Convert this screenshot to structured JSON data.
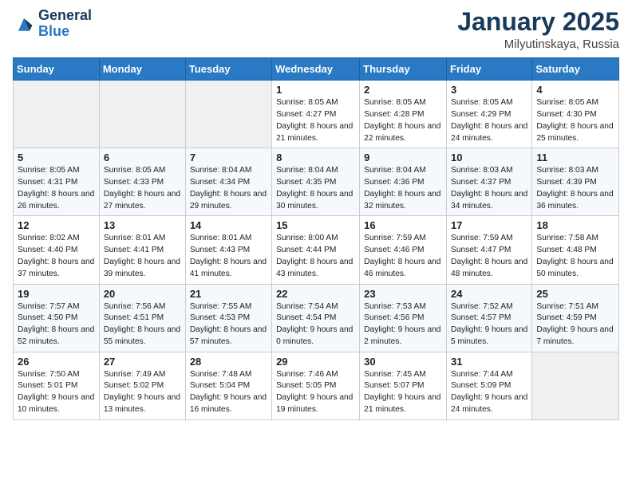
{
  "header": {
    "logo_general": "General",
    "logo_blue": "Blue",
    "month_year": "January 2025",
    "location": "Milyutinskaya, Russia"
  },
  "days_of_week": [
    "Sunday",
    "Monday",
    "Tuesday",
    "Wednesday",
    "Thursday",
    "Friday",
    "Saturday"
  ],
  "weeks": [
    [
      {
        "day": "",
        "info": ""
      },
      {
        "day": "",
        "info": ""
      },
      {
        "day": "",
        "info": ""
      },
      {
        "day": "1",
        "info": "Sunrise: 8:05 AM\nSunset: 4:27 PM\nDaylight: 8 hours and 21 minutes."
      },
      {
        "day": "2",
        "info": "Sunrise: 8:05 AM\nSunset: 4:28 PM\nDaylight: 8 hours and 22 minutes."
      },
      {
        "day": "3",
        "info": "Sunrise: 8:05 AM\nSunset: 4:29 PM\nDaylight: 8 hours and 24 minutes."
      },
      {
        "day": "4",
        "info": "Sunrise: 8:05 AM\nSunset: 4:30 PM\nDaylight: 8 hours and 25 minutes."
      }
    ],
    [
      {
        "day": "5",
        "info": "Sunrise: 8:05 AM\nSunset: 4:31 PM\nDaylight: 8 hours and 26 minutes."
      },
      {
        "day": "6",
        "info": "Sunrise: 8:05 AM\nSunset: 4:33 PM\nDaylight: 8 hours and 27 minutes."
      },
      {
        "day": "7",
        "info": "Sunrise: 8:04 AM\nSunset: 4:34 PM\nDaylight: 8 hours and 29 minutes."
      },
      {
        "day": "8",
        "info": "Sunrise: 8:04 AM\nSunset: 4:35 PM\nDaylight: 8 hours and 30 minutes."
      },
      {
        "day": "9",
        "info": "Sunrise: 8:04 AM\nSunset: 4:36 PM\nDaylight: 8 hours and 32 minutes."
      },
      {
        "day": "10",
        "info": "Sunrise: 8:03 AM\nSunset: 4:37 PM\nDaylight: 8 hours and 34 minutes."
      },
      {
        "day": "11",
        "info": "Sunrise: 8:03 AM\nSunset: 4:39 PM\nDaylight: 8 hours and 36 minutes."
      }
    ],
    [
      {
        "day": "12",
        "info": "Sunrise: 8:02 AM\nSunset: 4:40 PM\nDaylight: 8 hours and 37 minutes."
      },
      {
        "day": "13",
        "info": "Sunrise: 8:01 AM\nSunset: 4:41 PM\nDaylight: 8 hours and 39 minutes."
      },
      {
        "day": "14",
        "info": "Sunrise: 8:01 AM\nSunset: 4:43 PM\nDaylight: 8 hours and 41 minutes."
      },
      {
        "day": "15",
        "info": "Sunrise: 8:00 AM\nSunset: 4:44 PM\nDaylight: 8 hours and 43 minutes."
      },
      {
        "day": "16",
        "info": "Sunrise: 7:59 AM\nSunset: 4:46 PM\nDaylight: 8 hours and 46 minutes."
      },
      {
        "day": "17",
        "info": "Sunrise: 7:59 AM\nSunset: 4:47 PM\nDaylight: 8 hours and 48 minutes."
      },
      {
        "day": "18",
        "info": "Sunrise: 7:58 AM\nSunset: 4:48 PM\nDaylight: 8 hours and 50 minutes."
      }
    ],
    [
      {
        "day": "19",
        "info": "Sunrise: 7:57 AM\nSunset: 4:50 PM\nDaylight: 8 hours and 52 minutes."
      },
      {
        "day": "20",
        "info": "Sunrise: 7:56 AM\nSunset: 4:51 PM\nDaylight: 8 hours and 55 minutes."
      },
      {
        "day": "21",
        "info": "Sunrise: 7:55 AM\nSunset: 4:53 PM\nDaylight: 8 hours and 57 minutes."
      },
      {
        "day": "22",
        "info": "Sunrise: 7:54 AM\nSunset: 4:54 PM\nDaylight: 9 hours and 0 minutes."
      },
      {
        "day": "23",
        "info": "Sunrise: 7:53 AM\nSunset: 4:56 PM\nDaylight: 9 hours and 2 minutes."
      },
      {
        "day": "24",
        "info": "Sunrise: 7:52 AM\nSunset: 4:57 PM\nDaylight: 9 hours and 5 minutes."
      },
      {
        "day": "25",
        "info": "Sunrise: 7:51 AM\nSunset: 4:59 PM\nDaylight: 9 hours and 7 minutes."
      }
    ],
    [
      {
        "day": "26",
        "info": "Sunrise: 7:50 AM\nSunset: 5:01 PM\nDaylight: 9 hours and 10 minutes."
      },
      {
        "day": "27",
        "info": "Sunrise: 7:49 AM\nSunset: 5:02 PM\nDaylight: 9 hours and 13 minutes."
      },
      {
        "day": "28",
        "info": "Sunrise: 7:48 AM\nSunset: 5:04 PM\nDaylight: 9 hours and 16 minutes."
      },
      {
        "day": "29",
        "info": "Sunrise: 7:46 AM\nSunset: 5:05 PM\nDaylight: 9 hours and 19 minutes."
      },
      {
        "day": "30",
        "info": "Sunrise: 7:45 AM\nSunset: 5:07 PM\nDaylight: 9 hours and 21 minutes."
      },
      {
        "day": "31",
        "info": "Sunrise: 7:44 AM\nSunset: 5:09 PM\nDaylight: 9 hours and 24 minutes."
      },
      {
        "day": "",
        "info": ""
      }
    ]
  ]
}
